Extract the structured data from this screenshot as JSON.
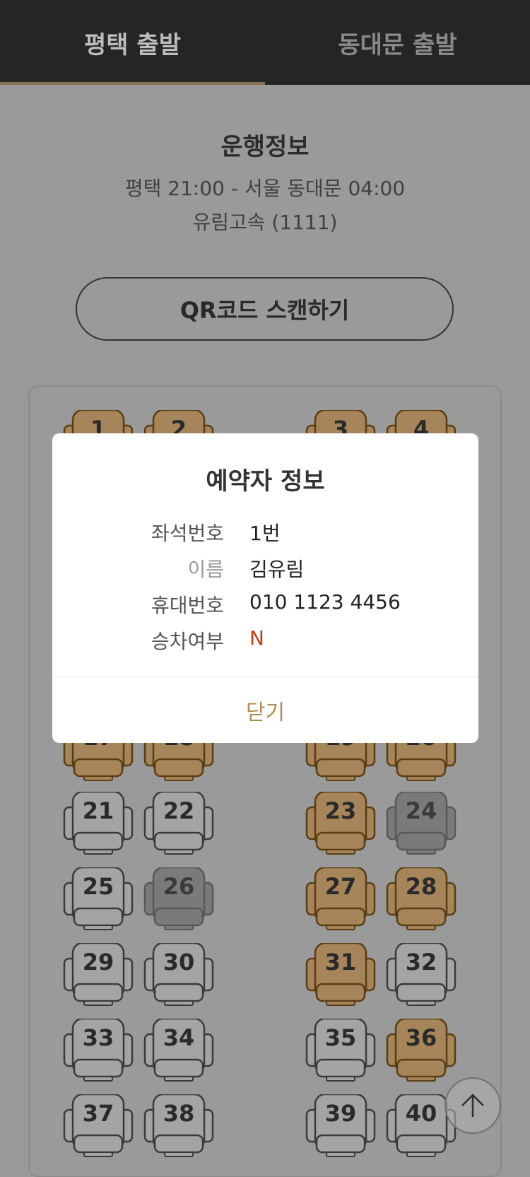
{
  "tabs": [
    {
      "label": "평택 출발",
      "active": true
    },
    {
      "label": "동대문 출발",
      "active": false
    }
  ],
  "trip": {
    "title": "운행정보",
    "route": "평택 21:00 - 서울 동대문 04:00",
    "bus": "유림고속 (1111)"
  },
  "qr_button": "QR코드 스캔하기",
  "seat_colors": {
    "reserved": "#a6855b",
    "reserved_outline": "#5a3d12",
    "available": "#a4a4a4",
    "available_outline": "#3a3a3a",
    "blocked": "#7a7a7a",
    "blocked_outline": "#585858"
  },
  "seats": [
    {
      "number": "1",
      "state": "reserved"
    },
    {
      "number": "2",
      "state": "reserved"
    },
    {
      "number": "3",
      "state": "reserved"
    },
    {
      "number": "4",
      "state": "reserved"
    },
    {
      "number": "17",
      "state": "reserved"
    },
    {
      "number": "18",
      "state": "reserved"
    },
    {
      "number": "19",
      "state": "reserved"
    },
    {
      "number": "20",
      "state": "reserved"
    },
    {
      "number": "21",
      "state": "available"
    },
    {
      "number": "22",
      "state": "available"
    },
    {
      "number": "23",
      "state": "reserved"
    },
    {
      "number": "24",
      "state": "blocked"
    },
    {
      "number": "25",
      "state": "available"
    },
    {
      "number": "26",
      "state": "blocked"
    },
    {
      "number": "27",
      "state": "reserved"
    },
    {
      "number": "28",
      "state": "reserved"
    },
    {
      "number": "29",
      "state": "available"
    },
    {
      "number": "30",
      "state": "available"
    },
    {
      "number": "31",
      "state": "reserved"
    },
    {
      "number": "32",
      "state": "available"
    },
    {
      "number": "33",
      "state": "available"
    },
    {
      "number": "34",
      "state": "available"
    },
    {
      "number": "35",
      "state": "available"
    },
    {
      "number": "36",
      "state": "reserved"
    },
    {
      "number": "37",
      "state": "available"
    },
    {
      "number": "38",
      "state": "available"
    },
    {
      "number": "39",
      "state": "available"
    },
    {
      "number": "40",
      "state": "available"
    }
  ],
  "modal": {
    "title": "예약자 정보",
    "seat_label": "좌석번호",
    "seat_value": "1번",
    "name_label": "이름",
    "name_value": "김유림",
    "phone_label": "휴대번호",
    "phone_value": "010 1123 4456",
    "boarded_label": "승차여부",
    "boarded_value": "N",
    "close_label": "닫기"
  },
  "scroll_top_icon": "arrow-up-icon"
}
